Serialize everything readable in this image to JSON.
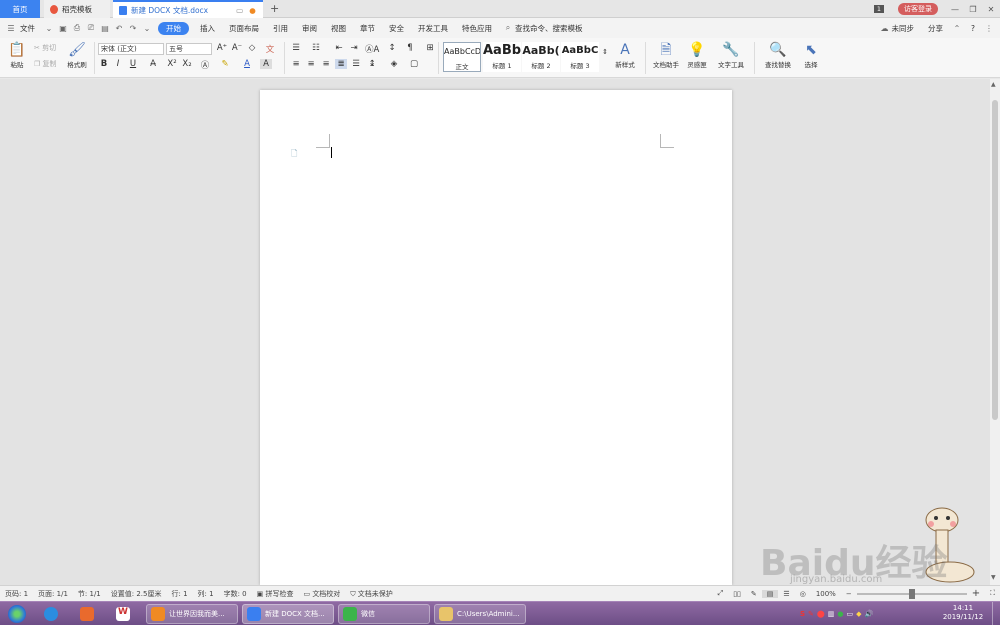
{
  "tabs": {
    "home": "首页",
    "templates": "稻壳模板",
    "doc": "新建 DOCX 文档.docx",
    "new_tab": "+"
  },
  "window": {
    "badge": "1",
    "login": "访客登录",
    "minimize": "—",
    "restore": "❐",
    "close": "✕"
  },
  "menu": {
    "file": "文件",
    "items": [
      "开始",
      "插入",
      "页面布局",
      "引用",
      "审阅",
      "视图",
      "章节",
      "安全",
      "开发工具",
      "特色应用"
    ],
    "search": "查找命令、搜索模板",
    "sync": "未同步",
    "share": "分享",
    "help": "?"
  },
  "ribbon": {
    "paste": "粘贴",
    "cut": "剪切",
    "copy": "复制",
    "format_painter": "格式刷",
    "font_name": "宋体 (正文)",
    "font_size": "五号",
    "bold": "B",
    "italic": "I",
    "underline": "U",
    "styles": [
      {
        "sample": "AaBbCcDd",
        "name": "正文"
      },
      {
        "sample": "AaBb",
        "name": "标题 1"
      },
      {
        "sample": "AaBb(",
        "name": "标题 2"
      },
      {
        "sample": "AaBbC",
        "name": "标题 3"
      }
    ],
    "new_style": "新样式",
    "doc_assistant": "文档助手",
    "inspiration": "灵感匣",
    "text_tools": "文字工具",
    "find_replace": "查找替换",
    "select": "选择"
  },
  "status": {
    "page_num": "页码: 1",
    "pages": "页面: 1/1",
    "section": "节: 1/1",
    "setting": "设置值: 2.5厘米",
    "row": "行: 1",
    "col": "列: 1",
    "words": "字数: 0",
    "spell": "拼写检查",
    "proof": "文档校对",
    "protect": "文档未保护",
    "zoom": "100%"
  },
  "taskbar": {
    "item1": "让世界因我而美...",
    "item2": "新建 DOCX 文档...",
    "item3": "微信",
    "item4": "C:\\Users\\Admini...",
    "time": "14:11",
    "date": "2019/11/12"
  },
  "watermark": {
    "brand": "Baidu经验",
    "url": "jingyan.baidu.com"
  },
  "colors": {
    "accent": "#3c83f0",
    "taskbar": "#7a5a91",
    "login": "#d45d5d"
  }
}
